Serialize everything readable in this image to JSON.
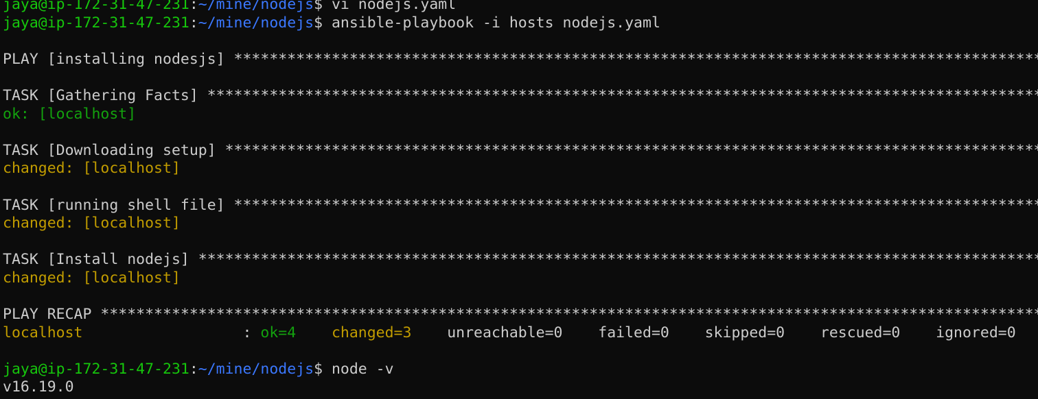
{
  "colors": {
    "background": "#0c0c0c",
    "foreground": "#cccccc",
    "prompt_user": "#16c60c",
    "prompt_path": "#3b78ff",
    "ok": "#13a10e",
    "changed": "#c19c00"
  },
  "lines": [
    {
      "segments": [
        {
          "text": "jaya@ip-172-31-47-231",
          "color": "green"
        },
        {
          "text": ":",
          "color": "white"
        },
        {
          "text": "~/mine/nodejs",
          "color": "blue"
        },
        {
          "text": "$ vi nodejs.yaml",
          "color": "white"
        }
      ]
    },
    {
      "segments": [
        {
          "text": "jaya@ip-172-31-47-231",
          "color": "green"
        },
        {
          "text": ":",
          "color": "white"
        },
        {
          "text": "~/mine/nodejs",
          "color": "blue"
        },
        {
          "text": "$ ansible-playbook -i hosts nodejs.yaml",
          "color": "white"
        }
      ]
    },
    {
      "segments": []
    },
    {
      "segments": [
        {
          "text": "PLAY [installing nodesjs] ****************************************************************************************************************************************",
          "color": "white"
        }
      ]
    },
    {
      "segments": []
    },
    {
      "segments": [
        {
          "text": "TASK [Gathering Facts] *******************************************************************************************************************************************",
          "color": "white"
        }
      ]
    },
    {
      "segments": [
        {
          "text": "ok: [localhost]",
          "color": "okgreen"
        }
      ]
    },
    {
      "segments": []
    },
    {
      "segments": [
        {
          "text": "TASK [Downloading setup] *****************************************************************************************************************************************",
          "color": "white"
        }
      ]
    },
    {
      "segments": [
        {
          "text": "changed: [localhost]",
          "color": "yellow"
        }
      ]
    },
    {
      "segments": []
    },
    {
      "segments": [
        {
          "text": "TASK [running shell file] ****************************************************************************************************************************************",
          "color": "white"
        }
      ]
    },
    {
      "segments": [
        {
          "text": "changed: [localhost]",
          "color": "yellow"
        }
      ]
    },
    {
      "segments": []
    },
    {
      "segments": [
        {
          "text": "TASK [Install nodejs] ********************************************************************************************************************************************",
          "color": "white"
        }
      ]
    },
    {
      "segments": [
        {
          "text": "changed: [localhost]",
          "color": "yellow"
        }
      ]
    },
    {
      "segments": []
    },
    {
      "segments": [
        {
          "text": "PLAY RECAP ***************************************************************************************************************************************************************",
          "color": "white"
        }
      ]
    },
    {
      "segments": [
        {
          "text": "localhost",
          "color": "yellow"
        },
        {
          "text": "                  : ",
          "color": "white"
        },
        {
          "text": "ok=4",
          "color": "okgreen"
        },
        {
          "text": "    ",
          "color": "white"
        },
        {
          "text": "changed=3",
          "color": "yellow"
        },
        {
          "text": "    unreachable=0    failed=0    skipped=0    rescued=0    ignored=0",
          "color": "white"
        }
      ]
    },
    {
      "segments": []
    },
    {
      "segments": [
        {
          "text": "jaya@ip-172-31-47-231",
          "color": "green"
        },
        {
          "text": ":",
          "color": "white"
        },
        {
          "text": "~/mine/nodejs",
          "color": "blue"
        },
        {
          "text": "$ node -v",
          "color": "white"
        }
      ]
    },
    {
      "segments": [
        {
          "text": "v16.19.0",
          "color": "white"
        }
      ]
    }
  ]
}
